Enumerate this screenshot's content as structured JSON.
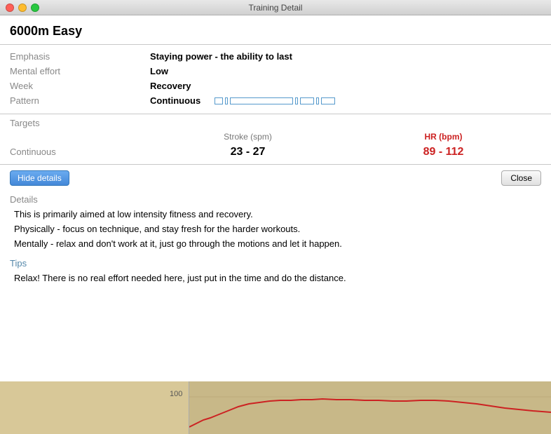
{
  "titleBar": {
    "title": "Training Detail"
  },
  "page": {
    "title": "6000m Easy"
  },
  "fields": {
    "emphasis_label": "Emphasis",
    "emphasis_value": "Staying power - the ability to last",
    "mental_label": "Mental effort",
    "mental_value": "Low",
    "week_label": "Week",
    "week_value": "Recovery",
    "pattern_label": "Pattern",
    "pattern_value": "Continuous"
  },
  "targets": {
    "header": "Targets",
    "col1": "Stroke (spm)",
    "col2": "HR (bpm)",
    "row_label": "Continuous",
    "stroke_value": "23 - 27",
    "hr_value": "89 - 112"
  },
  "buttons": {
    "hide_details": "Hide details",
    "close": "Close"
  },
  "details": {
    "header": "Details",
    "text_line1": "This is primarily aimed at low intensity fitness and recovery.",
    "text_line2": "Physically - focus on technique, and stay fresh for the harder workouts.",
    "text_line3": "Mentally - relax and don't work at it, just go through the motions and let it happen."
  },
  "tips": {
    "header": "Tips",
    "text": "Relax!  There is no real effort needed here, just put in the time and do the distance."
  },
  "chart": {
    "y_label": "100"
  }
}
